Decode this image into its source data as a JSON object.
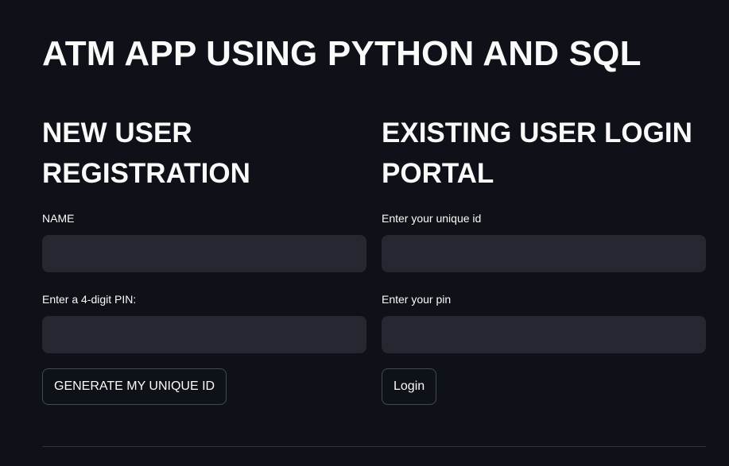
{
  "app": {
    "title": "ATM APP USING PYTHON AND SQL"
  },
  "registration": {
    "heading_line1": "NEW USER",
    "heading_line2": "REGISTRATION",
    "name_label": "NAME",
    "name_value": "",
    "pin_label": "Enter a 4-digit PIN:",
    "pin_value": "",
    "generate_button": "GENERATE MY UNIQUE ID"
  },
  "login": {
    "heading_line1": "EXISTING USER LOGIN",
    "heading_line2": "PORTAL",
    "id_label": "Enter your unique id",
    "id_value": "",
    "pin_label": "Enter your pin",
    "pin_value": "",
    "login_button": "Login"
  },
  "colors": {
    "background": "#0e1117",
    "input_background": "#262730",
    "text": "#fafafa",
    "button_border": "#454857",
    "divider": "#31333f"
  }
}
